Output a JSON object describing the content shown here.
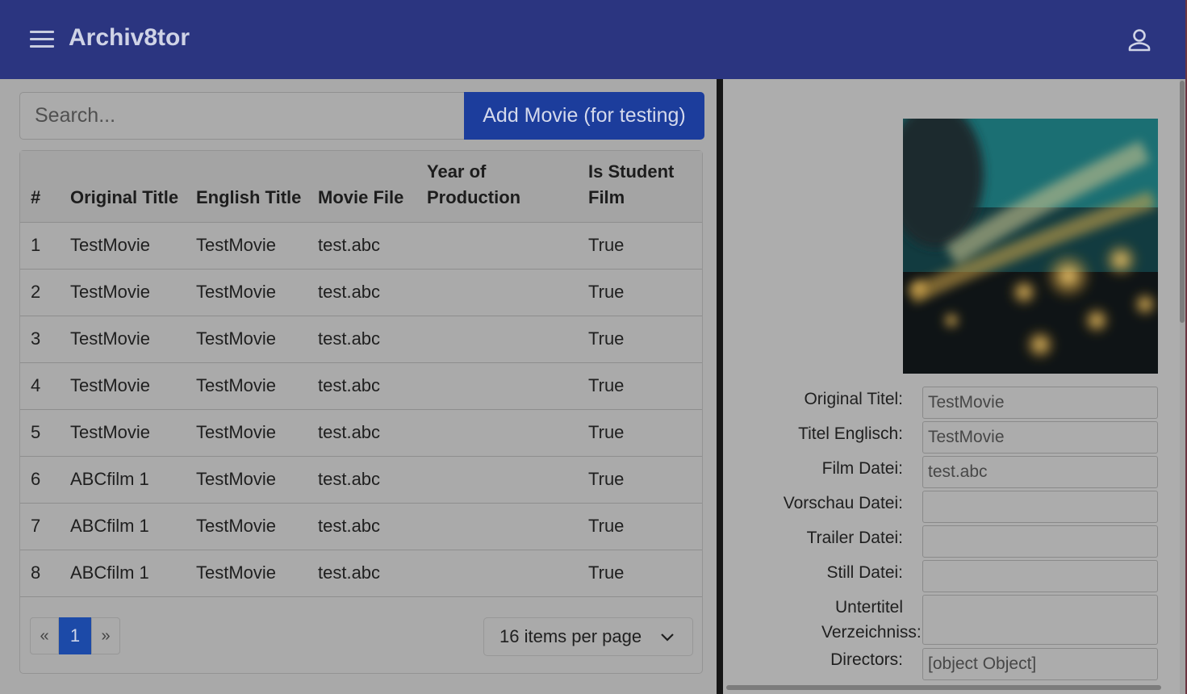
{
  "header": {
    "app_title": "Archiv8tor",
    "menu_icon": "hamburger-menu-icon",
    "profile_icon": "user-profile-icon",
    "background_color": "#2b3580"
  },
  "search": {
    "placeholder": "Search...",
    "value": ""
  },
  "toolbar": {
    "add_movie_label": "Add Movie (for testing)"
  },
  "table": {
    "columns": [
      "#",
      "Original Title",
      "English Title",
      "Movie File",
      "Year of Production",
      "Is Student Film"
    ],
    "rows": [
      {
        "num": "1",
        "original_title": "TestMovie",
        "english_title": "TestMovie",
        "movie_file": "test.abc",
        "year": "",
        "student": "True"
      },
      {
        "num": "2",
        "original_title": "TestMovie",
        "english_title": "TestMovie",
        "movie_file": "test.abc",
        "year": "",
        "student": "True"
      },
      {
        "num": "3",
        "original_title": "TestMovie",
        "english_title": "TestMovie",
        "movie_file": "test.abc",
        "year": "",
        "student": "True"
      },
      {
        "num": "4",
        "original_title": "TestMovie",
        "english_title": "TestMovie",
        "movie_file": "test.abc",
        "year": "",
        "student": "True"
      },
      {
        "num": "5",
        "original_title": "TestMovie",
        "english_title": "TestMovie",
        "movie_file": "test.abc",
        "year": "",
        "student": "True"
      },
      {
        "num": "6",
        "original_title": "ABCfilm 1",
        "english_title": "TestMovie",
        "movie_file": "test.abc",
        "year": "",
        "student": "True"
      },
      {
        "num": "7",
        "original_title": "ABCfilm 1",
        "english_title": "TestMovie",
        "movie_file": "test.abc",
        "year": "",
        "student": "True"
      },
      {
        "num": "8",
        "original_title": "ABCfilm 1",
        "english_title": "TestMovie",
        "movie_file": "test.abc",
        "year": "",
        "student": "True"
      }
    ]
  },
  "pagination": {
    "prev_label": "«",
    "current_page": "1",
    "next_label": "»",
    "per_page_label": "16 items per page"
  },
  "detail": {
    "fields": [
      {
        "label": "Original Titel:",
        "value": "TestMovie"
      },
      {
        "label": "Titel Englisch:",
        "value": "TestMovie"
      },
      {
        "label": "Film Datei:",
        "value": "test.abc"
      },
      {
        "label": "Vorschau Datei:",
        "value": ""
      },
      {
        "label": "Trailer Datei:",
        "value": ""
      },
      {
        "label": "Still Datei:",
        "value": ""
      },
      {
        "label": "Untertitel Verzeichniss:",
        "value": ""
      },
      {
        "label": "Directors:",
        "value": "[object Object]"
      }
    ]
  },
  "colors": {
    "accent": "#1c3d9c",
    "overlay_gray": "#a9a9a9"
  }
}
